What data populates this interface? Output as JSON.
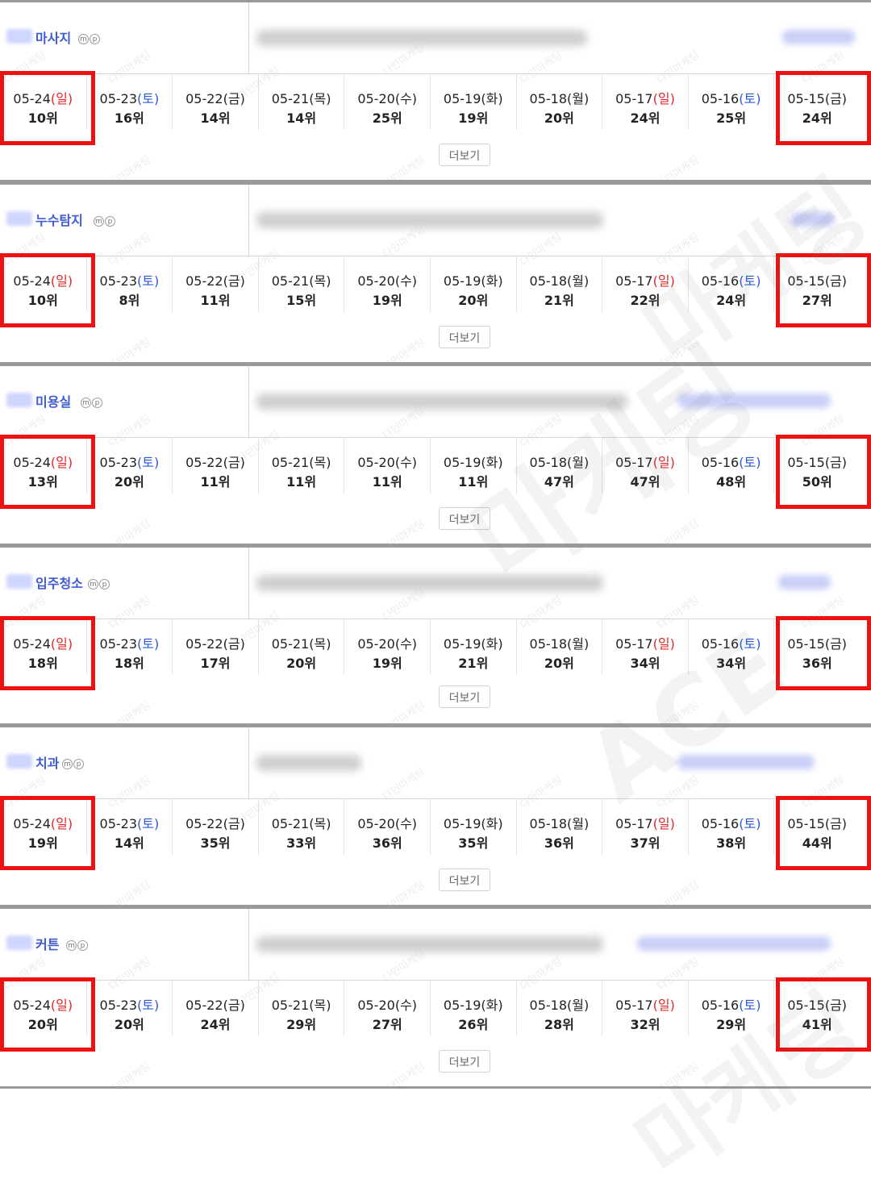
{
  "more_label": "더보기",
  "badges": [
    "m",
    "p"
  ],
  "colors": {
    "saturday": "#2b5ad9",
    "sunday": "#e0282a",
    "keyword": "#3f5bd6",
    "highlight": "#ee1111"
  },
  "icons": {
    "mobile_badge": "mobile-badge-icon",
    "pc_badge": "pc-badge-icon"
  },
  "dates": [
    {
      "md": "05-24",
      "wd": "일",
      "kind": "sun"
    },
    {
      "md": "05-23",
      "wd": "토",
      "kind": "sat"
    },
    {
      "md": "05-22",
      "wd": "금",
      "kind": "wk"
    },
    {
      "md": "05-21",
      "wd": "목",
      "kind": "wk"
    },
    {
      "md": "05-20",
      "wd": "수",
      "kind": "wk"
    },
    {
      "md": "05-19",
      "wd": "화",
      "kind": "wk"
    },
    {
      "md": "05-18",
      "wd": "월",
      "kind": "wk"
    },
    {
      "md": "05-17",
      "wd": "일",
      "kind": "sun"
    },
    {
      "md": "05-16",
      "wd": "토",
      "kind": "sat"
    },
    {
      "md": "05-15",
      "wd": "금",
      "kind": "wk"
    }
  ],
  "keywords": [
    {
      "name": "마사지",
      "ranks": [
        "10위",
        "16위",
        "14위",
        "14위",
        "25위",
        "19위",
        "20위",
        "24위",
        "25위",
        "24위"
      ]
    },
    {
      "name": "누수탐지",
      "ranks": [
        "10위",
        "8위",
        "11위",
        "15위",
        "19위",
        "20위",
        "21위",
        "22위",
        "24위",
        "27위"
      ]
    },
    {
      "name": "미용실",
      "ranks": [
        "13위",
        "20위",
        "11위",
        "11위",
        "11위",
        "11위",
        "47위",
        "47위",
        "48위",
        "50위"
      ]
    },
    {
      "name": "입주청소",
      "ranks": [
        "18위",
        "18위",
        "17위",
        "20위",
        "19위",
        "21위",
        "20위",
        "34위",
        "34위",
        "36위"
      ]
    },
    {
      "name": "치과",
      "ranks": [
        "19위",
        "14위",
        "35위",
        "33위",
        "36위",
        "35위",
        "36위",
        "37위",
        "38위",
        "44위"
      ]
    },
    {
      "name": "커튼",
      "ranks": [
        "20위",
        "20위",
        "24위",
        "29위",
        "27위",
        "26위",
        "28위",
        "32위",
        "29위",
        "41위"
      ]
    }
  ],
  "watermarks": [
    "다인마케팅",
    "ACE",
    "마케팅"
  ]
}
